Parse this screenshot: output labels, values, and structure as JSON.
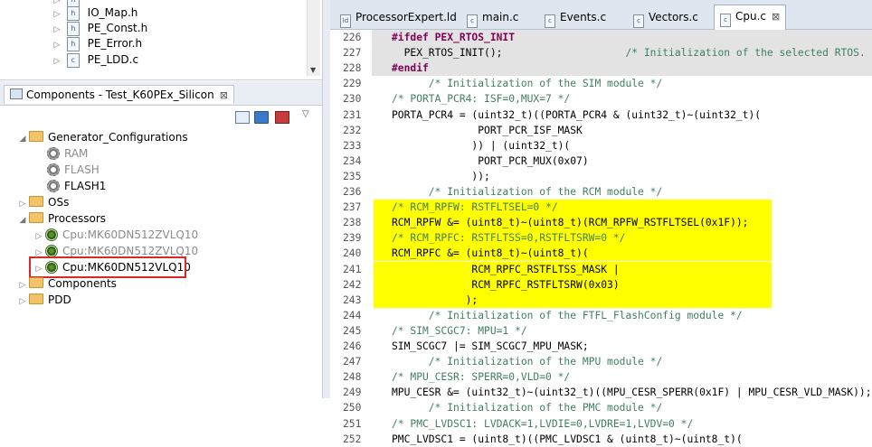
{
  "project_tree": {
    "items": [
      {
        "name": "IO_Map.h",
        "icon": "h"
      },
      {
        "name": "PE_Const.h",
        "icon": "h"
      },
      {
        "name": "PE_Error.h",
        "icon": "h"
      },
      {
        "name": "PE_LDD.c",
        "icon": "c"
      }
    ]
  },
  "components_view": {
    "tab_title": "Components - Test_K60PEx_Silicon",
    "close": "⊠",
    "tree": {
      "generator": "Generator_Configurations",
      "gen_children": [
        "RAM",
        "FLASH",
        "FLASH1"
      ],
      "oss": "OSs",
      "processors": "Processors",
      "proc_children": [
        "Cpu:MK60DN512ZVLQ10",
        "Cpu:MK60DN512ZVLQ10",
        "Cpu:MK60DN512VLQ10"
      ],
      "components": "Components",
      "pdd": "PDD"
    }
  },
  "editor": {
    "tabs": [
      {
        "label": "ProcessorExpert.ld",
        "icon": "ld"
      },
      {
        "label": "main.c",
        "icon": "c"
      },
      {
        "label": "Events.c",
        "icon": "c"
      },
      {
        "label": "Vectors.c",
        "icon": "c"
      },
      {
        "label": "Cpu.c",
        "icon": "c",
        "close": "⊠"
      }
    ],
    "lines": [
      {
        "n": "226",
        "t": "#ifdef PEX_RTOS_INIT",
        "bg": "grey",
        "style": "pp"
      },
      {
        "n": "227",
        "t": "  PEX_RTOS_INIT();                    /* Initialization of the selected RTOS.",
        "bg": "grey",
        "style": "mixed"
      },
      {
        "n": "228",
        "t": "#endif",
        "bg": "grey",
        "style": "pp"
      },
      {
        "n": "229",
        "t": "      /* Initialization of the SIM module */",
        "bg": "",
        "style": "cm"
      },
      {
        "n": "230",
        "t": "/* PORTA_PCR4: ISF=0,MUX=7 */",
        "bg": "",
        "style": "cm"
      },
      {
        "n": "231",
        "t": "PORTA_PCR4 = (uint32_t)((PORTA_PCR4 & (uint32_t)~(uint32_t)(",
        "bg": "",
        "style": ""
      },
      {
        "n": "232",
        "t": "              PORT_PCR_ISF_MASK",
        "bg": "",
        "style": ""
      },
      {
        "n": "233",
        "t": "             )) | (uint32_t)(",
        "bg": "",
        "style": ""
      },
      {
        "n": "234",
        "t": "              PORT_PCR_MUX(0x07)",
        "bg": "",
        "style": ""
      },
      {
        "n": "235",
        "t": "             ));",
        "bg": "",
        "style": ""
      },
      {
        "n": "236",
        "t": "      /* Initialization of the RCM module */",
        "bg": "",
        "style": "cm"
      },
      {
        "n": "237",
        "t": "/* RCM_RPFW: RSTFLTSEL=0 */",
        "bg": "yellow",
        "style": "cm"
      },
      {
        "n": "238",
        "t": "RCM_RPFW &= (uint8_t)~(uint8_t)(RCM_RPFW_RSTFLTSEL(0x1F));",
        "bg": "yellow",
        "style": ""
      },
      {
        "n": "239",
        "t": "/* RCM_RPFC: RSTFLTSS=0,RSTFLTSRW=0 */",
        "bg": "yellow",
        "style": "cm"
      },
      {
        "n": "240",
        "t": "RCM_RPFC &= (uint8_t)~(uint8_t)(",
        "bg": "yellow",
        "style": ""
      },
      {
        "n": "241",
        "t": "             RCM_RPFC_RSTFLTSS_MASK |",
        "bg": "yellow",
        "style": ""
      },
      {
        "n": "242",
        "t": "             RCM_RPFC_RSTFLTSRW(0x03)",
        "bg": "yellow",
        "style": ""
      },
      {
        "n": "243",
        "t": "            );",
        "bg": "yellow",
        "style": ""
      },
      {
        "n": "244",
        "t": "      /* Initialization of the FTFL_FlashConfig module */",
        "bg": "",
        "style": "cm"
      },
      {
        "n": "245",
        "t": "/* SIM_SCGC7: MPU=1 */",
        "bg": "",
        "style": "cm"
      },
      {
        "n": "246",
        "t": "SIM_SCGC7 |= SIM_SCGC7_MPU_MASK;",
        "bg": "",
        "style": ""
      },
      {
        "n": "247",
        "t": "      /* Initialization of the MPU module */",
        "bg": "",
        "style": "cm"
      },
      {
        "n": "248",
        "t": "/* MPU_CESR: SPERR=0,VLD=0 */",
        "bg": "",
        "style": "cm"
      },
      {
        "n": "249",
        "t": "MPU_CESR &= (uint32_t)~(uint32_t)((MPU_CESR_SPERR(0x1F) | MPU_CESR_VLD_MASK));",
        "bg": "",
        "style": ""
      },
      {
        "n": "250",
        "t": "      /* Initialization of the PMC module */",
        "bg": "",
        "style": "cm"
      },
      {
        "n": "251",
        "t": "/* PMC_LVDSC1: LVDACK=1,LVDIE=0,LVDRE=1,LVDV=0 */",
        "bg": "",
        "style": "cm"
      },
      {
        "n": "252",
        "t": "PMC_LVDSC1 = (uint8_t)((PMC_LVDSC1 & (uint8_t)~(uint8_t)(",
        "bg": "",
        "style": ""
      }
    ]
  },
  "colors": {
    "highlight": "#ffff00",
    "selection_box": "#d8282a",
    "comment": "#3f7f5f",
    "preprocessor": "#7f0055"
  }
}
